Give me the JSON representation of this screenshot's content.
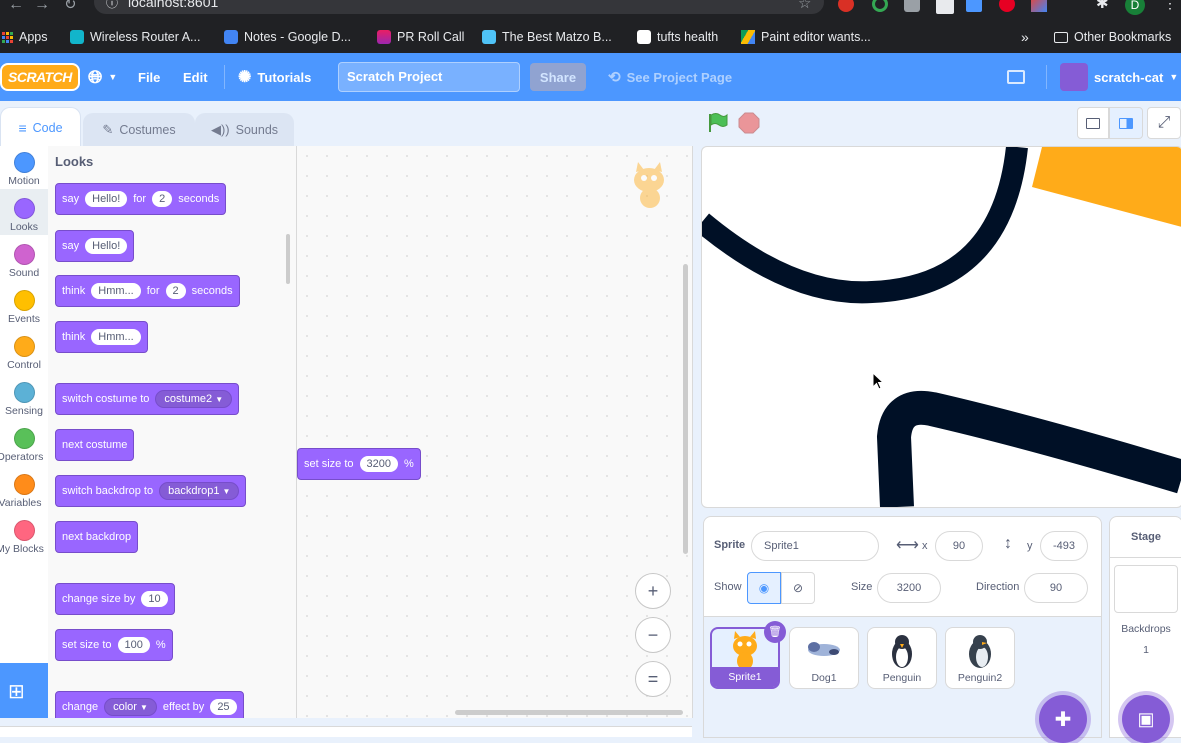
{
  "browser": {
    "url": "localhost:8601",
    "bookmarks": [
      "Apps",
      "Wireless Router A...",
      "Notes - Google D...",
      "PR Roll Call",
      "The Best Matzo B...",
      "tufts health",
      "Paint editor wants..."
    ],
    "bookmarks_more": "»",
    "other_bookmarks": "Other Bookmarks",
    "profile_initial": "D"
  },
  "menu": {
    "logo": "SCRATCH",
    "file": "File",
    "edit": "Edit",
    "tutorials": "Tutorials",
    "project_title": "Scratch Project",
    "share": "Share",
    "see_project": "See Project Page",
    "user": "scratch-cat"
  },
  "tabs": {
    "code": "Code",
    "costumes": "Costumes",
    "sounds": "Sounds"
  },
  "categories": [
    {
      "label": "Motion",
      "color": "#4c97ff"
    },
    {
      "label": "Looks",
      "color": "#9966ff"
    },
    {
      "label": "Sound",
      "color": "#cf63cf"
    },
    {
      "label": "Events",
      "color": "#ffbf00"
    },
    {
      "label": "Control",
      "color": "#ffab19"
    },
    {
      "label": "Sensing",
      "color": "#5cb1d6"
    },
    {
      "label": "Operators",
      "color": "#59c059"
    },
    {
      "label": "Variables",
      "color": "#ff8c1a"
    },
    {
      "label": "My Blocks",
      "color": "#ff6680"
    }
  ],
  "palette": {
    "heading": "Looks",
    "say_for": {
      "say": "say",
      "msg": "Hello!",
      "for": "for",
      "secs": "2",
      "seconds": "seconds"
    },
    "say": {
      "say": "say",
      "msg": "Hello!"
    },
    "think_for": {
      "think": "think",
      "msg": "Hmm...",
      "for": "for",
      "secs": "2",
      "seconds": "seconds"
    },
    "think": {
      "think": "think",
      "msg": "Hmm..."
    },
    "switch_costume": {
      "label": "switch costume to",
      "value": "costume2"
    },
    "next_costume": "next costume",
    "switch_backdrop": {
      "label": "switch backdrop to",
      "value": "backdrop1"
    },
    "next_backdrop": "next backdrop",
    "change_size": {
      "label": "change size by",
      "value": "10"
    },
    "set_size": {
      "label": "set size to",
      "value": "100",
      "unit": "%"
    },
    "change_effect": {
      "label": "change",
      "effect": "color",
      "by": "effect by",
      "value": "25"
    }
  },
  "script": {
    "set_size": {
      "label": "set size to",
      "value": "3200",
      "unit": "%"
    },
    "zoom_in": "+",
    "zoom_out": "−",
    "zoom_reset": "="
  },
  "sprite_info": {
    "sprite_label": "Sprite",
    "sprite_name": "Sprite1",
    "x_label": "x",
    "x": "90",
    "y_label": "y",
    "y": "-493",
    "show_label": "Show",
    "size_label": "Size",
    "size": "3200",
    "direction_label": "Direction",
    "direction": "90"
  },
  "sprites": [
    "Sprite1",
    "Dog1",
    "Penguin",
    "Penguin2"
  ],
  "stage_panel": {
    "title": "Stage",
    "backdrops_label": "Backdrops",
    "backdrops_count": "1"
  },
  "colors": {
    "scratch_blue": "#4c97ff",
    "looks_purple": "#9966ff",
    "cat_orange": "#ffab19"
  }
}
